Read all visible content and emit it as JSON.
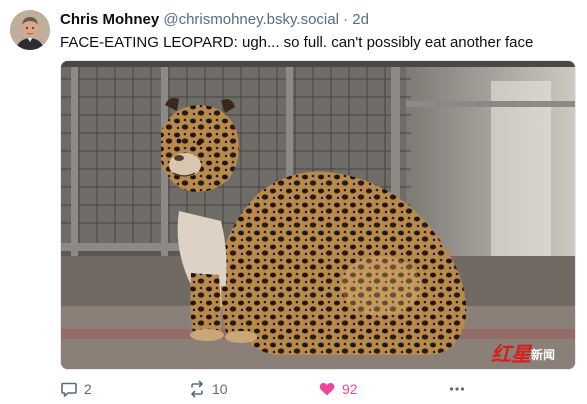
{
  "post": {
    "author_name": "Chris Mohney",
    "author_handle": "@chrismohney.bsky.social",
    "separator": "·",
    "age": "2d",
    "text": "FACE-EATING LEOPARD: ugh... so full. can't possibly eat another face",
    "image": {
      "subject": "leopard",
      "watermark": "红星新闻"
    }
  },
  "actions": {
    "reply": {
      "icon": "reply-icon",
      "count": "2"
    },
    "repost": {
      "icon": "repost-icon",
      "count": "10"
    },
    "like": {
      "icon": "heart-icon",
      "count": "92",
      "liked": true,
      "color": "#ec4899"
    },
    "more": {
      "icon": "more-icon"
    }
  },
  "colors": {
    "text": "#0b0f14",
    "muted": "#5a6b7d",
    "like_accent": "#ec4899",
    "watermark": "#d71f1f"
  }
}
